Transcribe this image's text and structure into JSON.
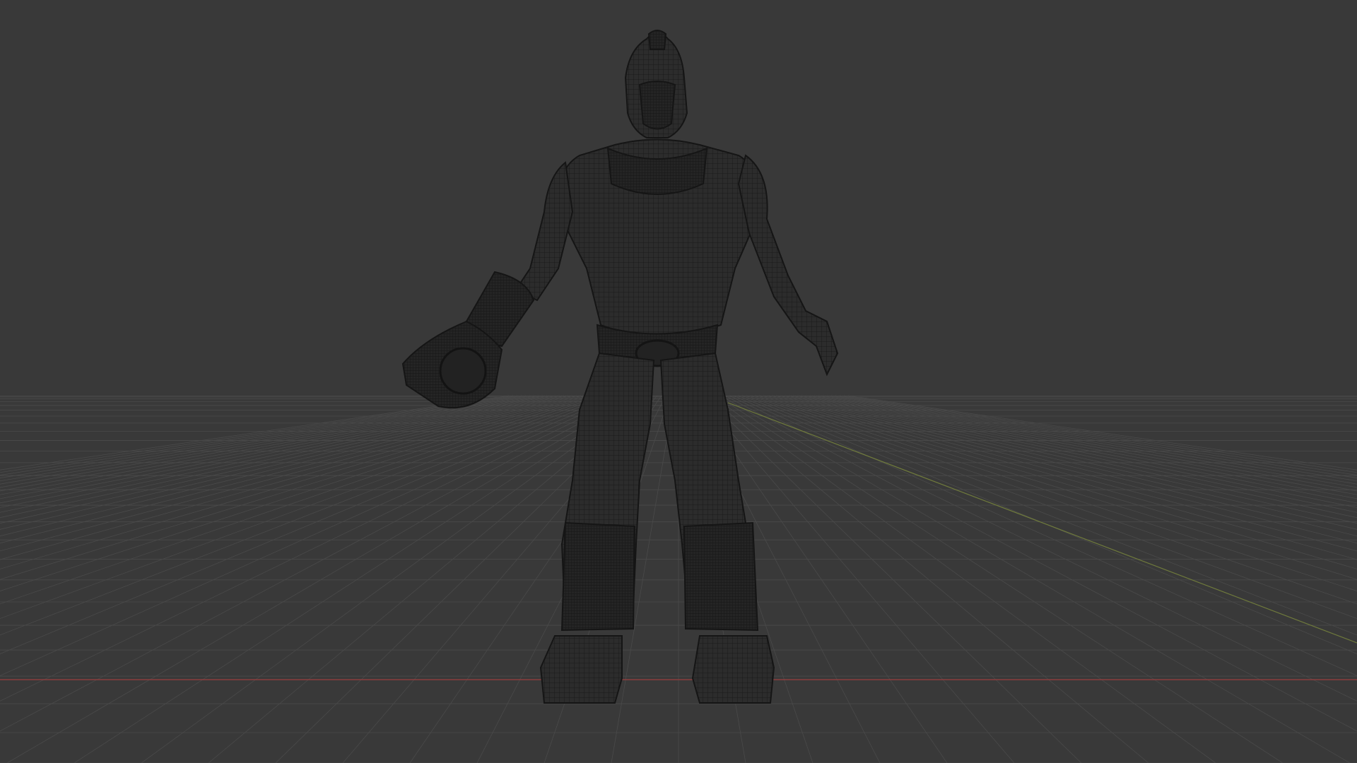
{
  "viewport": {
    "mode": "wireframe",
    "background_color": "#393939",
    "grid_color": "#4a4a4a",
    "x_axis_color": "#8a3e3e",
    "y_axis_color": "#6f7a3c",
    "wire_color": "#1a1a1a",
    "mesh_fill_color": "#2c2c2c"
  },
  "scene": {
    "object": "armored-humanoid-character"
  }
}
